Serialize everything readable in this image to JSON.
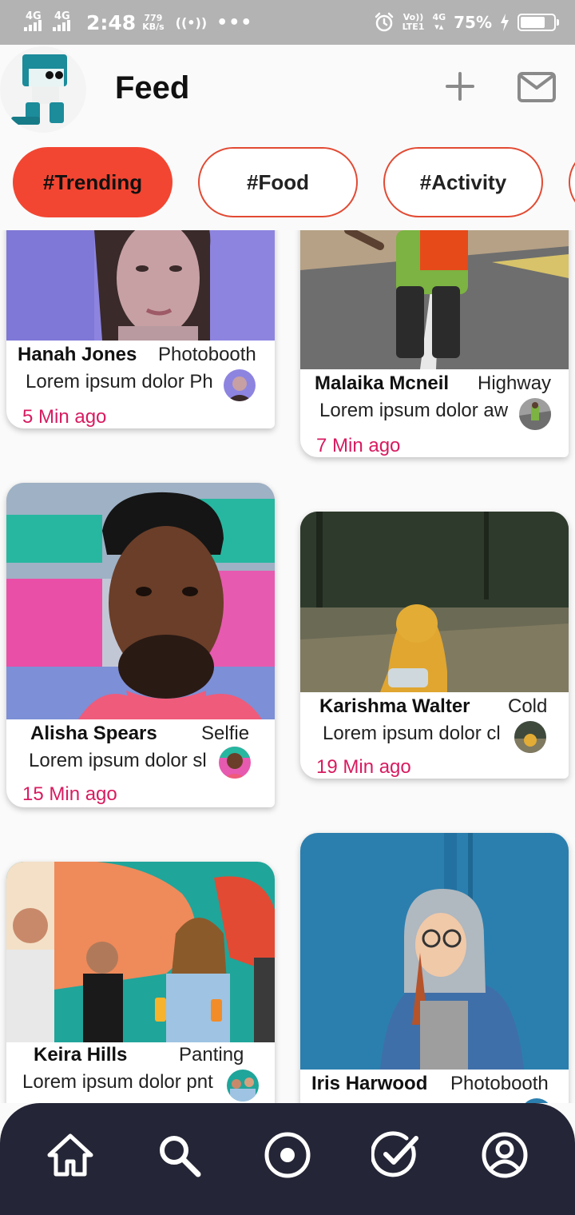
{
  "status_bar": {
    "network_1": "4G",
    "network_2": "4G",
    "time": "2:48",
    "speed_value": "779",
    "speed_unit": "KB/s",
    "hotspot": "((•))",
    "more": "•••",
    "volte": "Vo))",
    "lte": "LTE1",
    "network_3": "4G",
    "battery_percent": "75%",
    "battery_level": 0.75
  },
  "header": {
    "title": "Feed",
    "logo_icon": "robot-logo",
    "add_icon": "plus-icon",
    "mail_icon": "mail-icon"
  },
  "chips": [
    {
      "label": "#Trending",
      "active": true
    },
    {
      "label": "#Food",
      "active": false
    },
    {
      "label": "#Activity",
      "active": false
    },
    {
      "label": "",
      "active": false
    }
  ],
  "posts": [
    {
      "name": "Hanah Jones",
      "tag": "Photobooth",
      "desc": "Lorem ipsum dolor Ph",
      "time": "5 Min ago"
    },
    {
      "name": "Malaika Mcneil",
      "tag": "Highway",
      "desc": "Lorem ipsum dolor aw",
      "time": "7 Min ago"
    },
    {
      "name": "Alisha Spears",
      "tag": "Selfie",
      "desc": "Lorem ipsum dolor sl",
      "time": "15 Min ago"
    },
    {
      "name": "Karishma Walter",
      "tag": "Cold",
      "desc": "Lorem ipsum dolor cl",
      "time": "19 Min ago"
    },
    {
      "name": "Keira Hills",
      "tag": "Panting",
      "desc": "Lorem ipsum dolor pnt",
      "time": ""
    },
    {
      "name": "Iris Harwood",
      "tag": "Photobooth",
      "desc": "",
      "time": ""
    }
  ],
  "nav": [
    {
      "icon": "home-icon"
    },
    {
      "icon": "search-icon"
    },
    {
      "icon": "record-icon"
    },
    {
      "icon": "check-circle-icon"
    },
    {
      "icon": "account-icon"
    }
  ],
  "colors": {
    "accent": "#f24632",
    "time_text": "#d81b60",
    "nav_bg": "#242536",
    "status_bg": "#b3b3b3"
  }
}
